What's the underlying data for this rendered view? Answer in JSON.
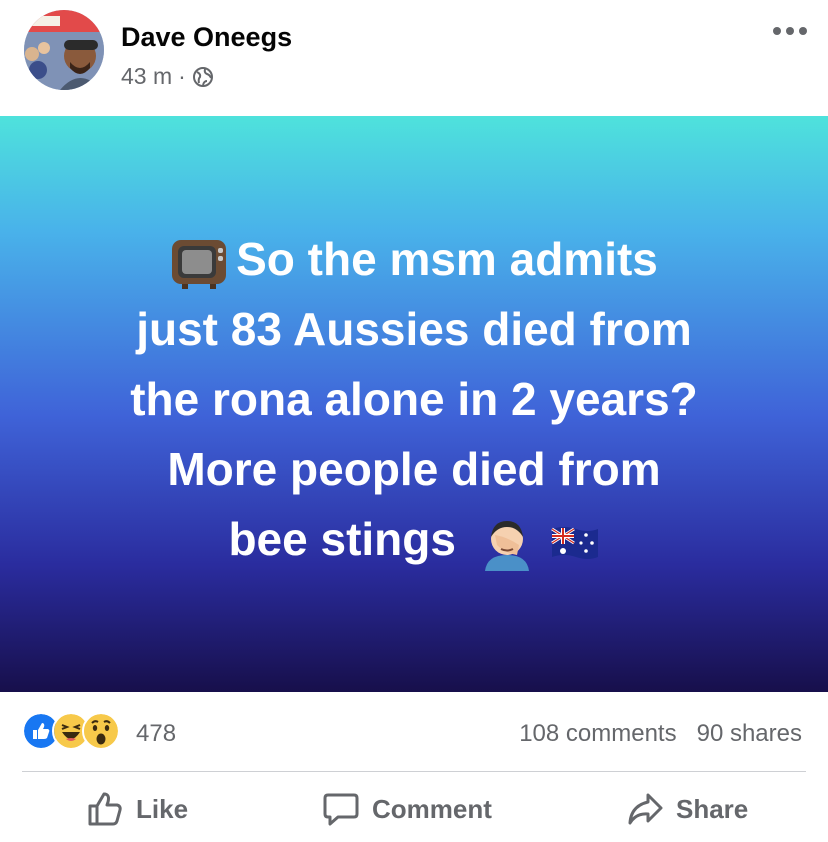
{
  "post": {
    "author": "Dave Oneegs",
    "time": "43 m",
    "separator": "·",
    "privacy_icon": "globe-icon",
    "text_lines": [
      "So the msm admits",
      "just 83 Aussies died from",
      "the rona alone in 2 years?",
      "More people died from",
      "bee stings"
    ],
    "emojis": [
      "television-emoji",
      "facepalm-emoji",
      "australia-flag-emoji"
    ]
  },
  "stats": {
    "reaction_count": "478",
    "comments": "108 comments",
    "shares": "90 shares",
    "reaction_icons": [
      "like-reaction-icon",
      "haha-reaction-icon",
      "wow-reaction-icon"
    ]
  },
  "actions": {
    "like": "Like",
    "comment": "Comment",
    "share": "Share"
  },
  "colors": {
    "gradient_top": "#4ee2dc",
    "gradient_bottom": "#170f4b",
    "like_blue": "#1877f2",
    "reaction_yellow": "#f7c94a",
    "secondary_text": "#65676b"
  }
}
